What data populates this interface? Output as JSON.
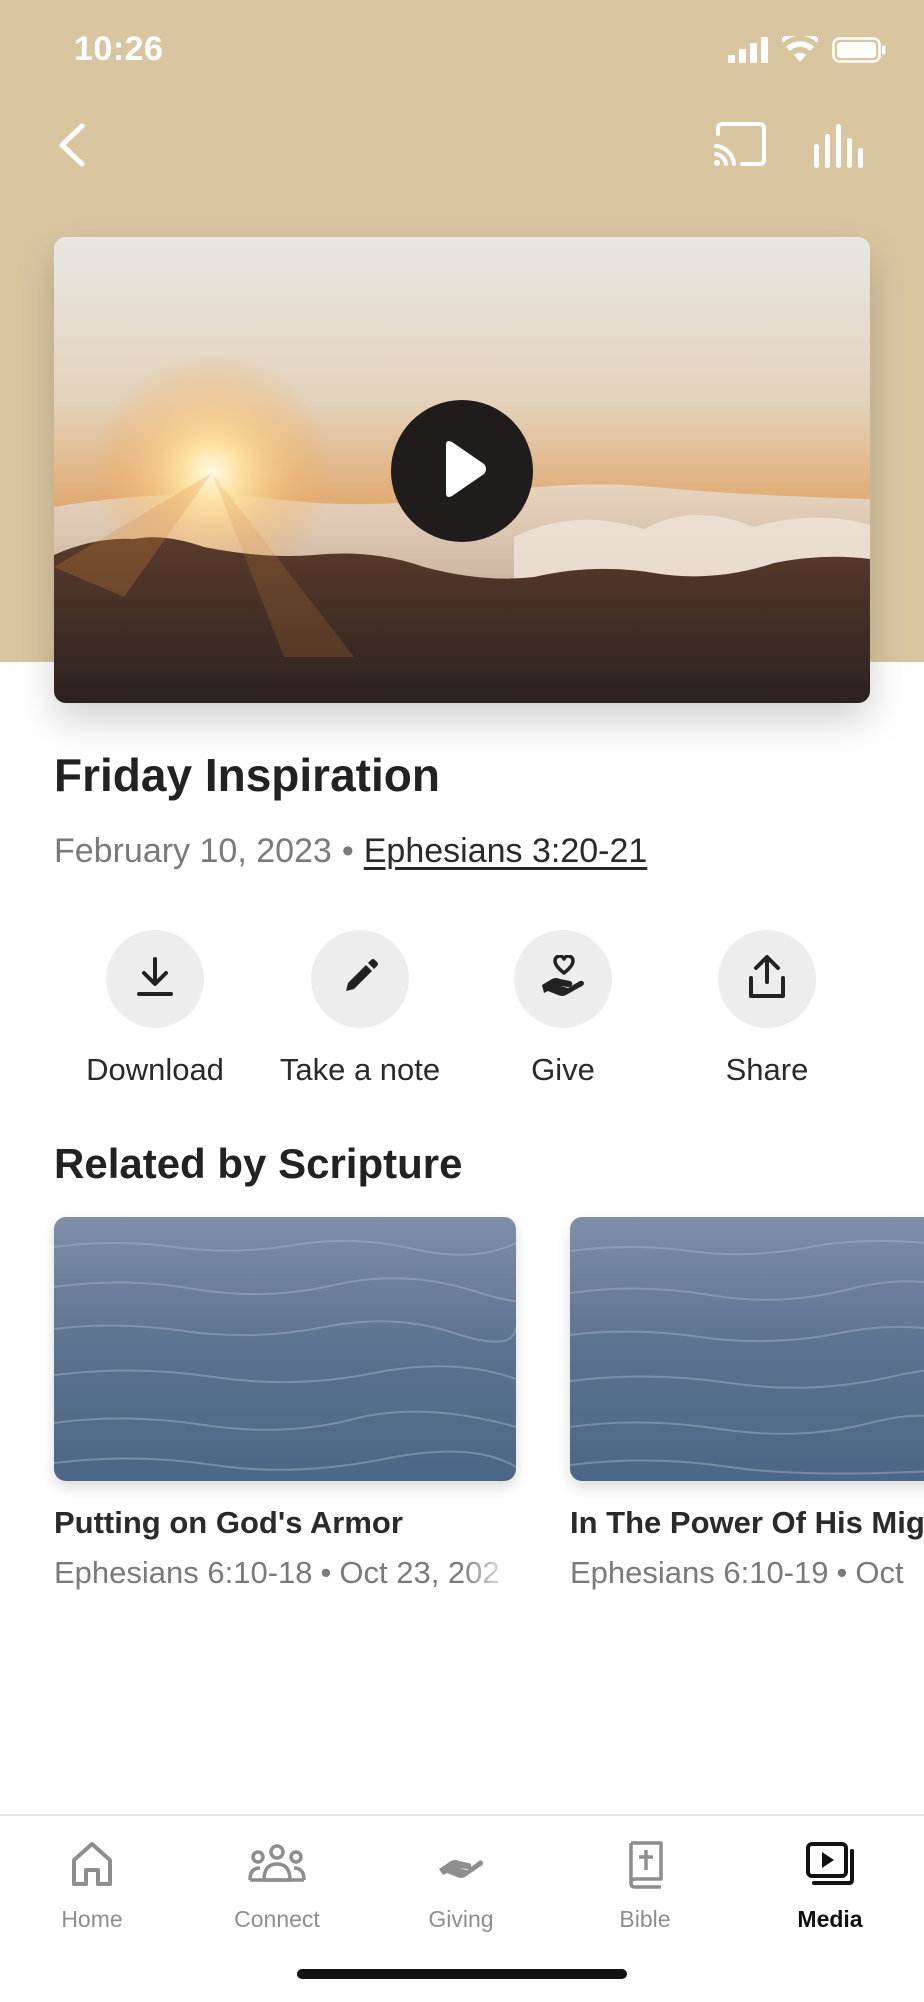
{
  "status_bar": {
    "time": "10:26"
  },
  "colors": {
    "hero_background": "#d9c6a1",
    "action_circle": "#ededed",
    "active_tab": "#111111",
    "inactive_tab": "#8e8e8e"
  },
  "nav": {
    "back_icon": "chevron-left-icon",
    "cast_icon": "cast-icon",
    "audio_icon": "audio-bars-icon"
  },
  "video": {
    "play_icon": "play-icon"
  },
  "sermon": {
    "title": "Friday Inspiration",
    "date": "February 10, 2023",
    "separator": "•",
    "scripture": "Ephesians 3:20-21"
  },
  "actions": [
    {
      "label": "Download",
      "icon": "download-icon"
    },
    {
      "label": "Take a note",
      "icon": "pencil-icon"
    },
    {
      "label": "Give",
      "icon": "hand-heart-icon"
    },
    {
      "label": "Share",
      "icon": "share-icon"
    }
  ],
  "related": {
    "title": "Related by Scripture",
    "items": [
      {
        "title": "Putting on God's Armor",
        "scripture": "Ephesians 6:10-18",
        "date": "Oct 23, 202"
      },
      {
        "title": "In The Power Of His Mig",
        "scripture": "Ephesians 6:10-19",
        "date": "Oct"
      }
    ]
  },
  "tabs": [
    {
      "label": "Home",
      "icon": "home-icon",
      "active": false
    },
    {
      "label": "Connect",
      "icon": "people-icon",
      "active": false
    },
    {
      "label": "Giving",
      "icon": "giving-hand-icon",
      "active": false
    },
    {
      "label": "Bible",
      "icon": "bible-icon",
      "active": false
    },
    {
      "label": "Media",
      "icon": "media-icon",
      "active": true
    }
  ]
}
